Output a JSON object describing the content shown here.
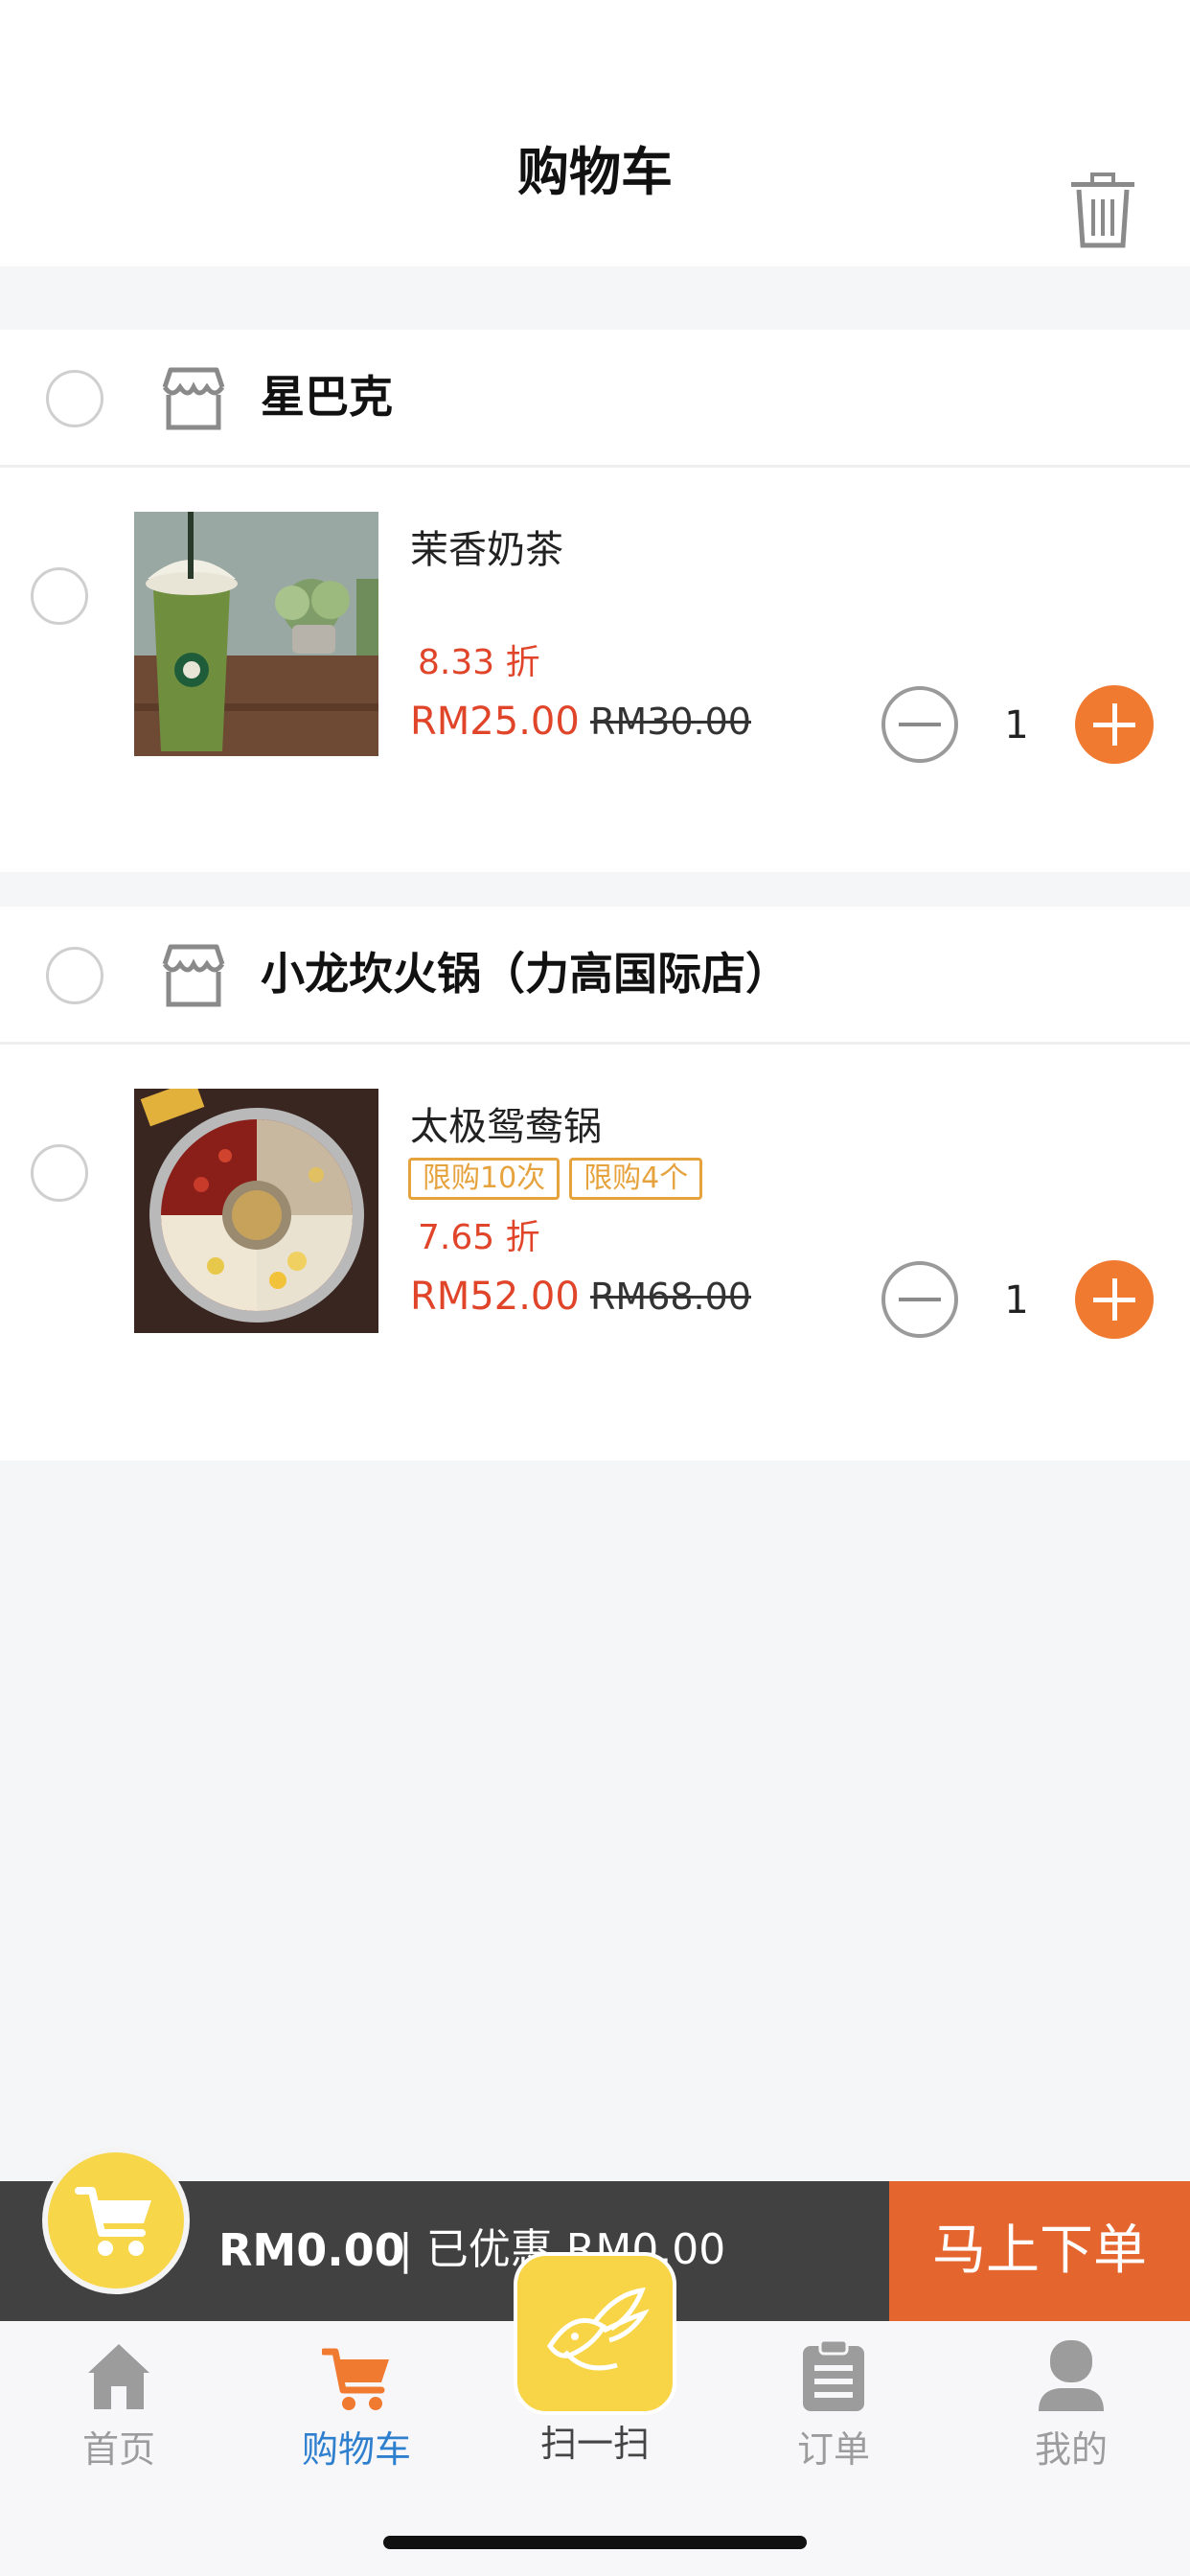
{
  "header": {
    "title": "购物车",
    "trash_icon": "trash-icon"
  },
  "stores": [
    {
      "name": "星巴克",
      "items": [
        {
          "name": "茉香奶茶",
          "tags": [],
          "discount": "8.33 折",
          "price": "RM25.00",
          "original_price": "RM30.00",
          "quantity": "1"
        }
      ]
    },
    {
      "name": "小龙坎火锅（力高国际店）",
      "items": [
        {
          "name": "太极鸳鸯锅",
          "tags": [
            "限购10次",
            "限购4个"
          ],
          "discount": "7.65 折",
          "price": "RM52.00",
          "original_price": "RM68.00",
          "quantity": "1"
        }
      ]
    }
  ],
  "checkout": {
    "total": "RM0.00",
    "savings": "| 已优惠 RM0.00",
    "submit_label": "马上下单"
  },
  "tabbar": {
    "tabs": [
      {
        "label": "首页",
        "icon": "home-icon"
      },
      {
        "label": "购物车",
        "icon": "cart-icon"
      },
      {
        "label": "扫一扫",
        "icon": "scan-logo-icon"
      },
      {
        "label": "订单",
        "icon": "clipboard-icon"
      },
      {
        "label": "我的",
        "icon": "user-icon"
      }
    ],
    "active": "购物车"
  },
  "colors": {
    "accent_orange": "#ef7a30",
    "price_red": "#e0452a",
    "tag_orange": "#e6a23c",
    "active_tab_blue": "#2f7fcf",
    "scan_yellow": "#f8d547",
    "checkout_bar": "#414141"
  }
}
